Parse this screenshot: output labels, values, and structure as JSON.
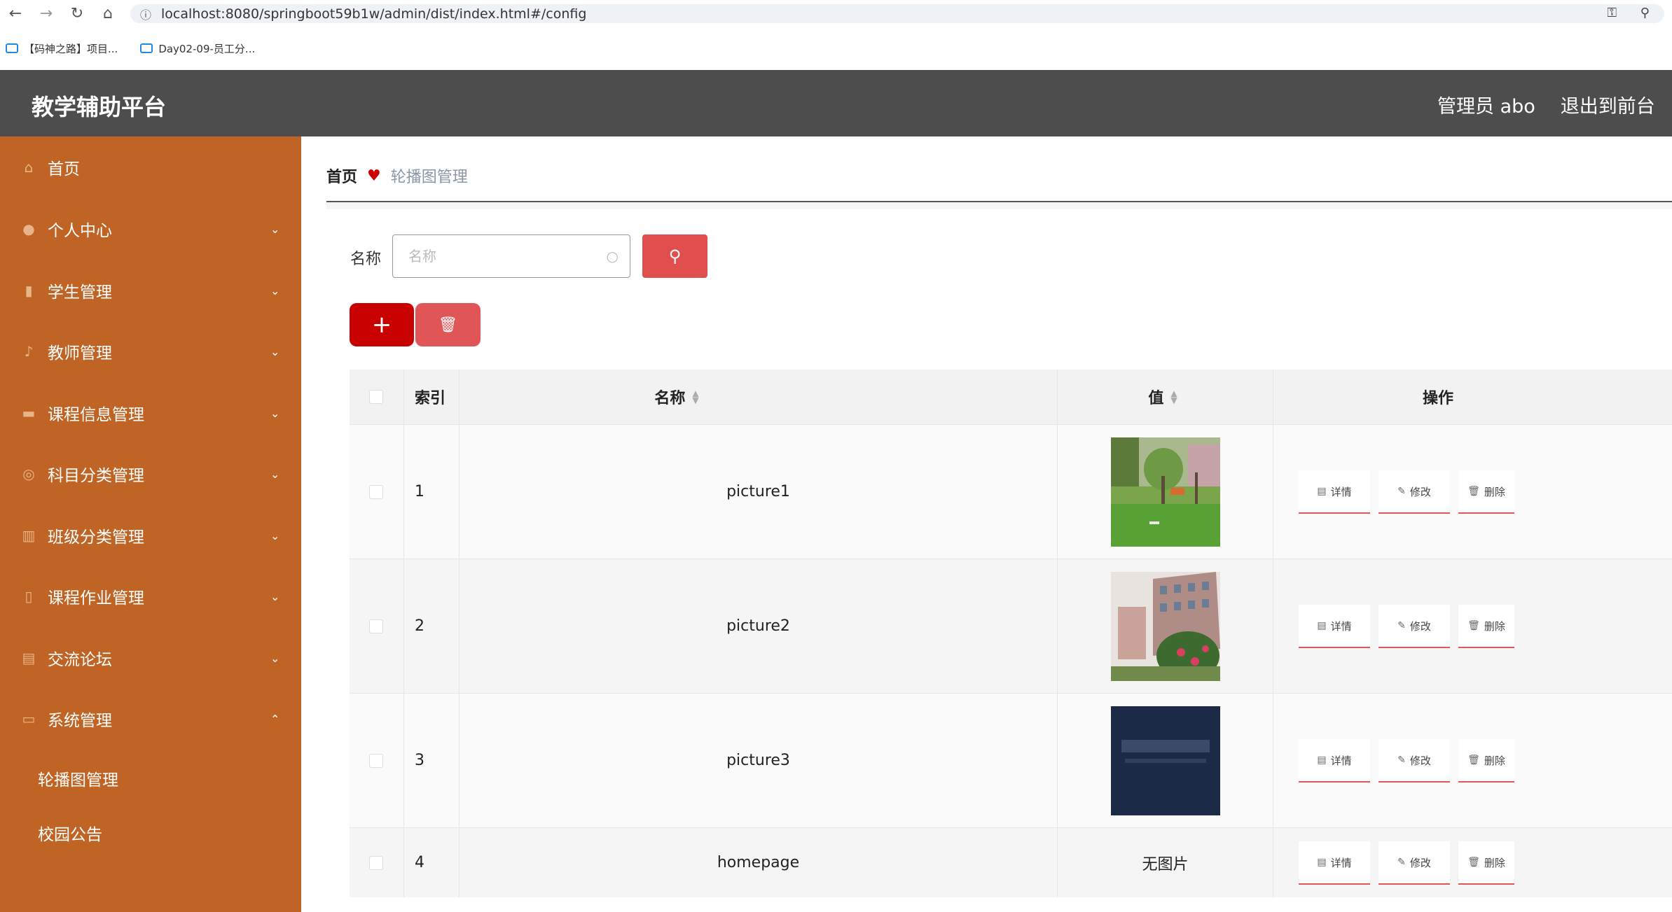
{
  "browser": {
    "url": "localhost:8080/springboot59b1w/admin/dist/index.html#/config",
    "bookmarks": [
      "【码神之路】项目...",
      "Day02-09-员工分..."
    ]
  },
  "header": {
    "title": "教学辅助平台",
    "user_label": "管理员 abo",
    "back_label": "退出到前台",
    "cut_label": "退"
  },
  "sidebar": {
    "items": [
      {
        "label": "首页",
        "icon": "home-icon",
        "arrow": ""
      },
      {
        "label": "个人中心",
        "icon": "user-icon",
        "arrow": "chevron-down"
      },
      {
        "label": "学生管理",
        "icon": "chart-icon",
        "arrow": "chevron-down"
      },
      {
        "label": "教师管理",
        "icon": "mic-icon",
        "arrow": "chevron-down"
      },
      {
        "label": "课程信息管理",
        "icon": "chat-icon",
        "arrow": "chevron-down"
      },
      {
        "label": "科目分类管理",
        "icon": "compass-icon",
        "arrow": "chevron-down"
      },
      {
        "label": "班级分类管理",
        "icon": "book-icon",
        "arrow": "chevron-down"
      },
      {
        "label": "课程作业管理",
        "icon": "phone-icon",
        "arrow": "chevron-down"
      },
      {
        "label": "交流论坛",
        "icon": "clipboard-icon",
        "arrow": "chevron-down"
      },
      {
        "label": "系统管理",
        "icon": "screen-icon",
        "arrow": "chevron-up"
      }
    ],
    "sub_items": [
      "轮播图管理",
      "校园公告"
    ]
  },
  "breadcrumb": {
    "home": "首页",
    "current": "轮播图管理"
  },
  "search": {
    "label": "名称",
    "placeholder": "名称"
  },
  "table": {
    "headers": {
      "index": "索引",
      "name": "名称",
      "value": "值",
      "actions": "操作"
    },
    "rows": [
      {
        "index": "1",
        "name": "picture1",
        "value": "",
        "image": "garden"
      },
      {
        "index": "2",
        "name": "picture2",
        "value": "",
        "image": "building"
      },
      {
        "index": "3",
        "name": "picture3",
        "value": "",
        "image": "banner"
      },
      {
        "index": "4",
        "name": "homepage",
        "value": "无图片",
        "image": ""
      }
    ],
    "actions": {
      "detail": "详情",
      "edit": "修改",
      "delete": "删除"
    }
  }
}
